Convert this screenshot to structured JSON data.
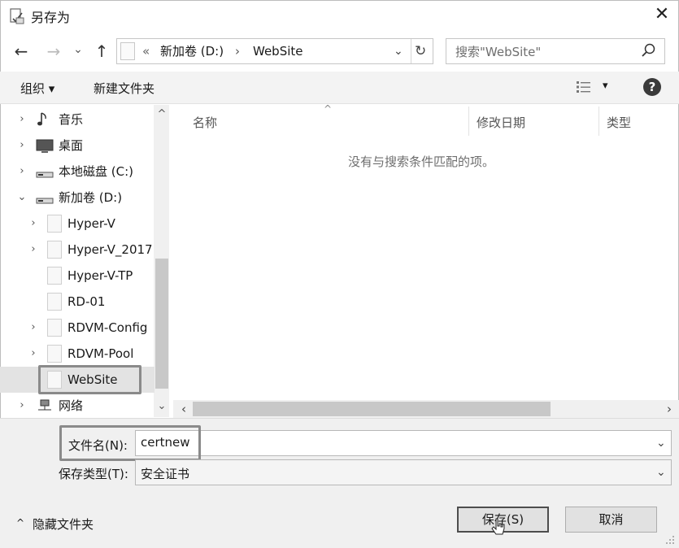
{
  "window": {
    "title": "另存为",
    "close_glyph": "✕"
  },
  "nav": {
    "back_glyph": "←",
    "forward_glyph": "→",
    "history_glyph": "⌄",
    "up_glyph": "↑",
    "breadcrumb_prefix": "«",
    "breadcrumb": [
      "新加卷 (D:)",
      "WebSite"
    ],
    "breadcrumb_sep": "›",
    "addr_dropdown_glyph": "⌄",
    "refresh_glyph": "↻",
    "search_placeholder": "搜索\"WebSite\""
  },
  "toolbar": {
    "organize": "组织 ▾",
    "new_folder": "新建文件夹",
    "view_glyph": "▾",
    "help_glyph": "?"
  },
  "tree": [
    {
      "label": "音乐",
      "icon": "music-note-icon",
      "chevron": "›",
      "indent": 0
    },
    {
      "label": "桌面",
      "icon": "desktop-icon",
      "chevron": "›",
      "indent": 0
    },
    {
      "label": "本地磁盘 (C:)",
      "icon": "drive-icon",
      "chevron": "›",
      "indent": 0
    },
    {
      "label": "新加卷 (D:)",
      "icon": "drive-icon",
      "chevron": "⌄",
      "indent": 0
    },
    {
      "label": "Hyper-V",
      "icon": "folder-icon",
      "chevron": "›",
      "indent": 1
    },
    {
      "label": "Hyper-V_2017",
      "icon": "folder-icon",
      "chevron": "›",
      "indent": 1
    },
    {
      "label": "Hyper-V-TP",
      "icon": "folder-icon",
      "chevron": "",
      "indent": 1
    },
    {
      "label": "RD-01",
      "icon": "folder-icon",
      "chevron": "",
      "indent": 1
    },
    {
      "label": "RDVM-Config",
      "icon": "folder-icon",
      "chevron": "›",
      "indent": 1
    },
    {
      "label": "RDVM-Pool",
      "icon": "folder-icon",
      "chevron": "›",
      "indent": 1
    },
    {
      "label": "WebSite",
      "icon": "folder-icon",
      "chevron": "",
      "indent": 1,
      "selected": true
    },
    {
      "label": "网络",
      "icon": "network-icon",
      "chevron": "›",
      "indent": 0
    }
  ],
  "list": {
    "sort_glyph": "^",
    "columns": [
      "名称",
      "修改日期",
      "类型"
    ],
    "empty_message": "没有与搜索条件匹配的项。",
    "scroll_up": "^",
    "scroll_down": "⌄",
    "scroll_left": "‹",
    "scroll_right": "›"
  },
  "form": {
    "filename_label": "文件名(N):",
    "filename_value": "certnew",
    "filetype_label": "保存类型(T):",
    "filetype_value": "安全证书",
    "combo_glyph": "⌄"
  },
  "footer": {
    "hide_folders_glyph": "^",
    "hide_folders": "隐藏文件夹",
    "save_button": "保存(S)",
    "cancel_button": "取消"
  },
  "colors": {
    "highlight_border": "#8a8a8a",
    "selected_row": "#e3e3e3"
  }
}
